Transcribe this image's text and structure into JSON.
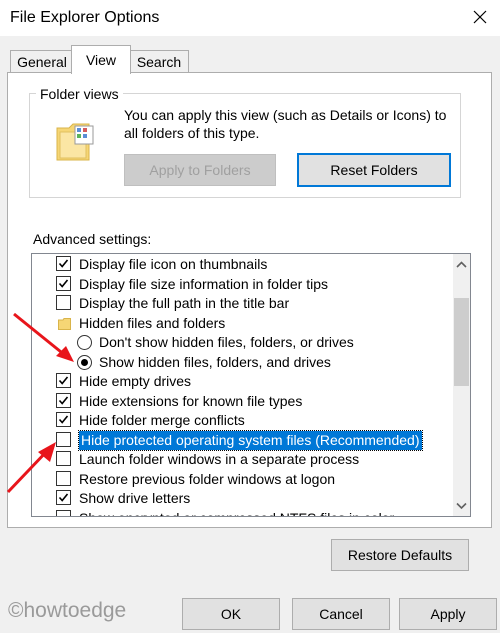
{
  "window": {
    "title": "File Explorer Options"
  },
  "tabs": [
    {
      "label": "General"
    },
    {
      "label": "View"
    },
    {
      "label": "Search"
    }
  ],
  "folder_views": {
    "group_label": "Folder views",
    "description": "You can apply this view (such as Details or Icons) to all folders of this type.",
    "apply_label": "Apply to Folders",
    "reset_label": "Reset Folders"
  },
  "advanced": {
    "label": "Advanced settings:",
    "items": [
      {
        "type": "checkbox",
        "checked": true,
        "label": "Display file icon on thumbnails"
      },
      {
        "type": "checkbox",
        "checked": true,
        "label": "Display file size information in folder tips"
      },
      {
        "type": "checkbox",
        "checked": false,
        "label": "Display the full path in the title bar"
      },
      {
        "type": "folder",
        "label": "Hidden files and folders"
      },
      {
        "type": "radio",
        "checked": false,
        "label": "Don't show hidden files, folders, or drives"
      },
      {
        "type": "radio",
        "checked": true,
        "label": "Show hidden files, folders, and drives"
      },
      {
        "type": "checkbox",
        "checked": true,
        "label": "Hide empty drives"
      },
      {
        "type": "checkbox",
        "checked": true,
        "label": "Hide extensions for known file types"
      },
      {
        "type": "checkbox",
        "checked": true,
        "label": "Hide folder merge conflicts"
      },
      {
        "type": "checkbox",
        "checked": false,
        "label": "Hide protected operating system files (Recommended)",
        "selected": true
      },
      {
        "type": "checkbox",
        "checked": false,
        "label": "Launch folder windows in a separate process"
      },
      {
        "type": "checkbox",
        "checked": false,
        "label": "Restore previous folder windows at logon"
      },
      {
        "type": "checkbox",
        "checked": true,
        "label": "Show drive letters"
      },
      {
        "type": "checkbox",
        "checked": false,
        "label": "Show encrypted or compressed NTFS files in color"
      }
    ],
    "restore_defaults_label": "Restore Defaults"
  },
  "footer": {
    "ok_label": "OK",
    "cancel_label": "Cancel",
    "apply_label": "Apply"
  },
  "watermark": "©howtoedge",
  "colors": {
    "selection": "#0078d7",
    "annotation_arrow": "#e8151b"
  }
}
